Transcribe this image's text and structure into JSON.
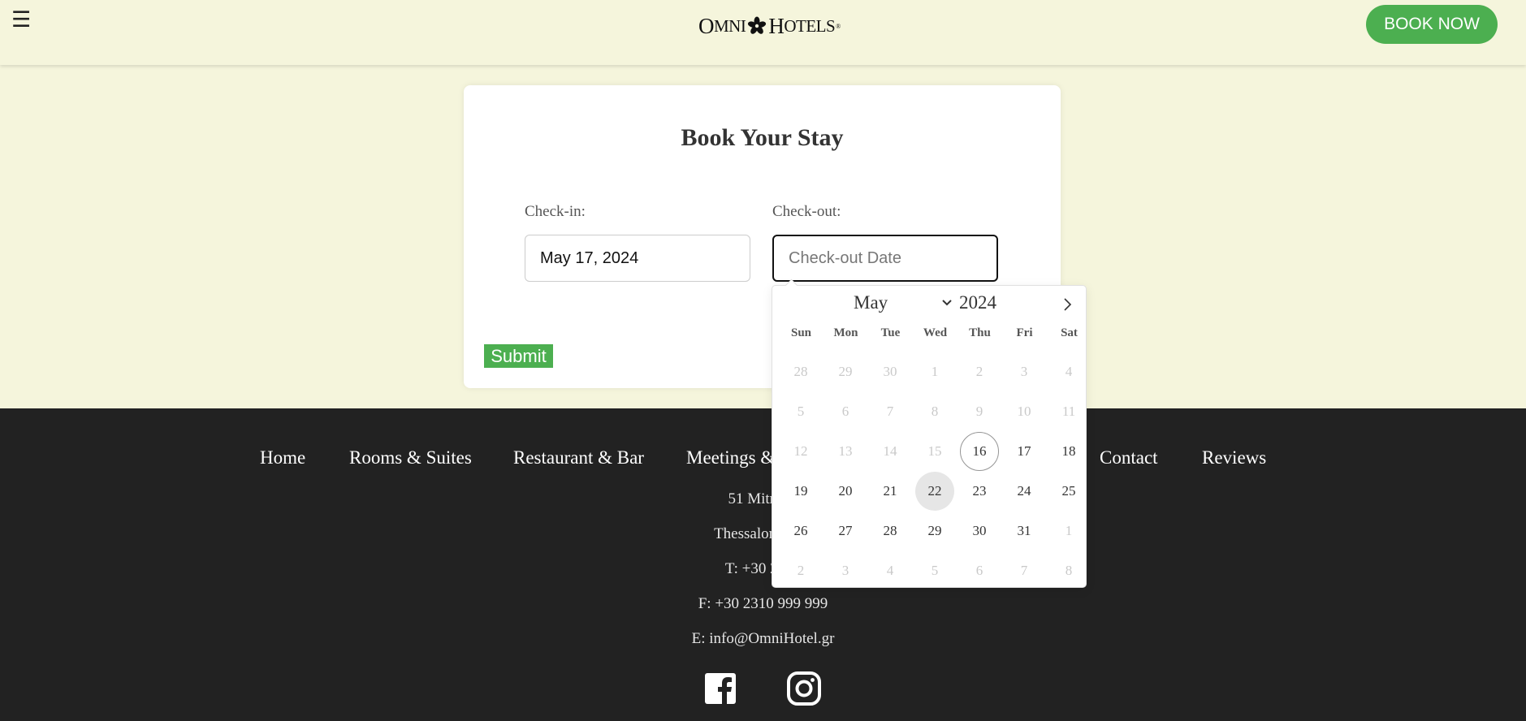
{
  "header": {
    "menu_icon": "☰",
    "logo": {
      "first": "O",
      "first_rest": "MNI",
      "second": "H",
      "second_rest": "OTELS",
      "mark": "®"
    },
    "book_now_label": "BOOK NOW"
  },
  "booking": {
    "title": "Book Your Stay",
    "checkin_label": "Check-in:",
    "checkin_value": "May 17, 2024",
    "checkout_label": "Check-out:",
    "checkout_value": "",
    "checkout_placeholder": "Check-out Date",
    "submit_label": "Submit"
  },
  "datepicker": {
    "month": "May",
    "year": "2024",
    "weekdays": [
      "Sun",
      "Mon",
      "Tue",
      "Wed",
      "Thu",
      "Fri",
      "Sat"
    ],
    "today": "16",
    "hovered": "22",
    "weeks": [
      [
        {
          "d": "28",
          "m": true
        },
        {
          "d": "29",
          "m": true
        },
        {
          "d": "30",
          "m": true
        },
        {
          "d": "1",
          "m": true
        },
        {
          "d": "2",
          "m": true
        },
        {
          "d": "3",
          "m": true
        },
        {
          "d": "4",
          "m": true
        }
      ],
      [
        {
          "d": "5",
          "m": true
        },
        {
          "d": "6",
          "m": true
        },
        {
          "d": "7",
          "m": true
        },
        {
          "d": "8",
          "m": true
        },
        {
          "d": "9",
          "m": true
        },
        {
          "d": "10",
          "m": true
        },
        {
          "d": "11",
          "m": true
        }
      ],
      [
        {
          "d": "12",
          "m": true
        },
        {
          "d": "13",
          "m": true
        },
        {
          "d": "14",
          "m": true
        },
        {
          "d": "15",
          "m": true
        },
        {
          "d": "16",
          "m": false
        },
        {
          "d": "17",
          "m": false
        },
        {
          "d": "18",
          "m": false
        }
      ],
      [
        {
          "d": "19",
          "m": false
        },
        {
          "d": "20",
          "m": false
        },
        {
          "d": "21",
          "m": false
        },
        {
          "d": "22",
          "m": false
        },
        {
          "d": "23",
          "m": false
        },
        {
          "d": "24",
          "m": false
        },
        {
          "d": "25",
          "m": false
        }
      ],
      [
        {
          "d": "26",
          "m": false
        },
        {
          "d": "27",
          "m": false
        },
        {
          "d": "28",
          "m": false
        },
        {
          "d": "29",
          "m": false
        },
        {
          "d": "30",
          "m": false
        },
        {
          "d": "31",
          "m": false
        },
        {
          "d": "1",
          "m": true
        }
      ],
      [
        {
          "d": "2",
          "m": true
        },
        {
          "d": "3",
          "m": true
        },
        {
          "d": "4",
          "m": true
        },
        {
          "d": "5",
          "m": true
        },
        {
          "d": "6",
          "m": true
        },
        {
          "d": "7",
          "m": true
        },
        {
          "d": "8",
          "m": true
        }
      ]
    ]
  },
  "footer": {
    "nav": [
      "Home",
      "Rooms & Suites",
      "Restaurant & Bar",
      "Meetings &",
      "Contact",
      "Reviews"
    ],
    "address_line1": "51 Mitropo",
    "address_line2": "Thessaloniki 54",
    "phone": "T: +30 2310",
    "fax": "F: +30 2310 999 999",
    "email": "E: info@OmniHotel.gr",
    "social": [
      "facebook-icon",
      "instagram-icon"
    ]
  },
  "colors": {
    "accent": "#4caf50",
    "background": "#f5f5dc",
    "footer": "#222222",
    "today_ring": "#959595",
    "hover": "#e6e6e6"
  }
}
